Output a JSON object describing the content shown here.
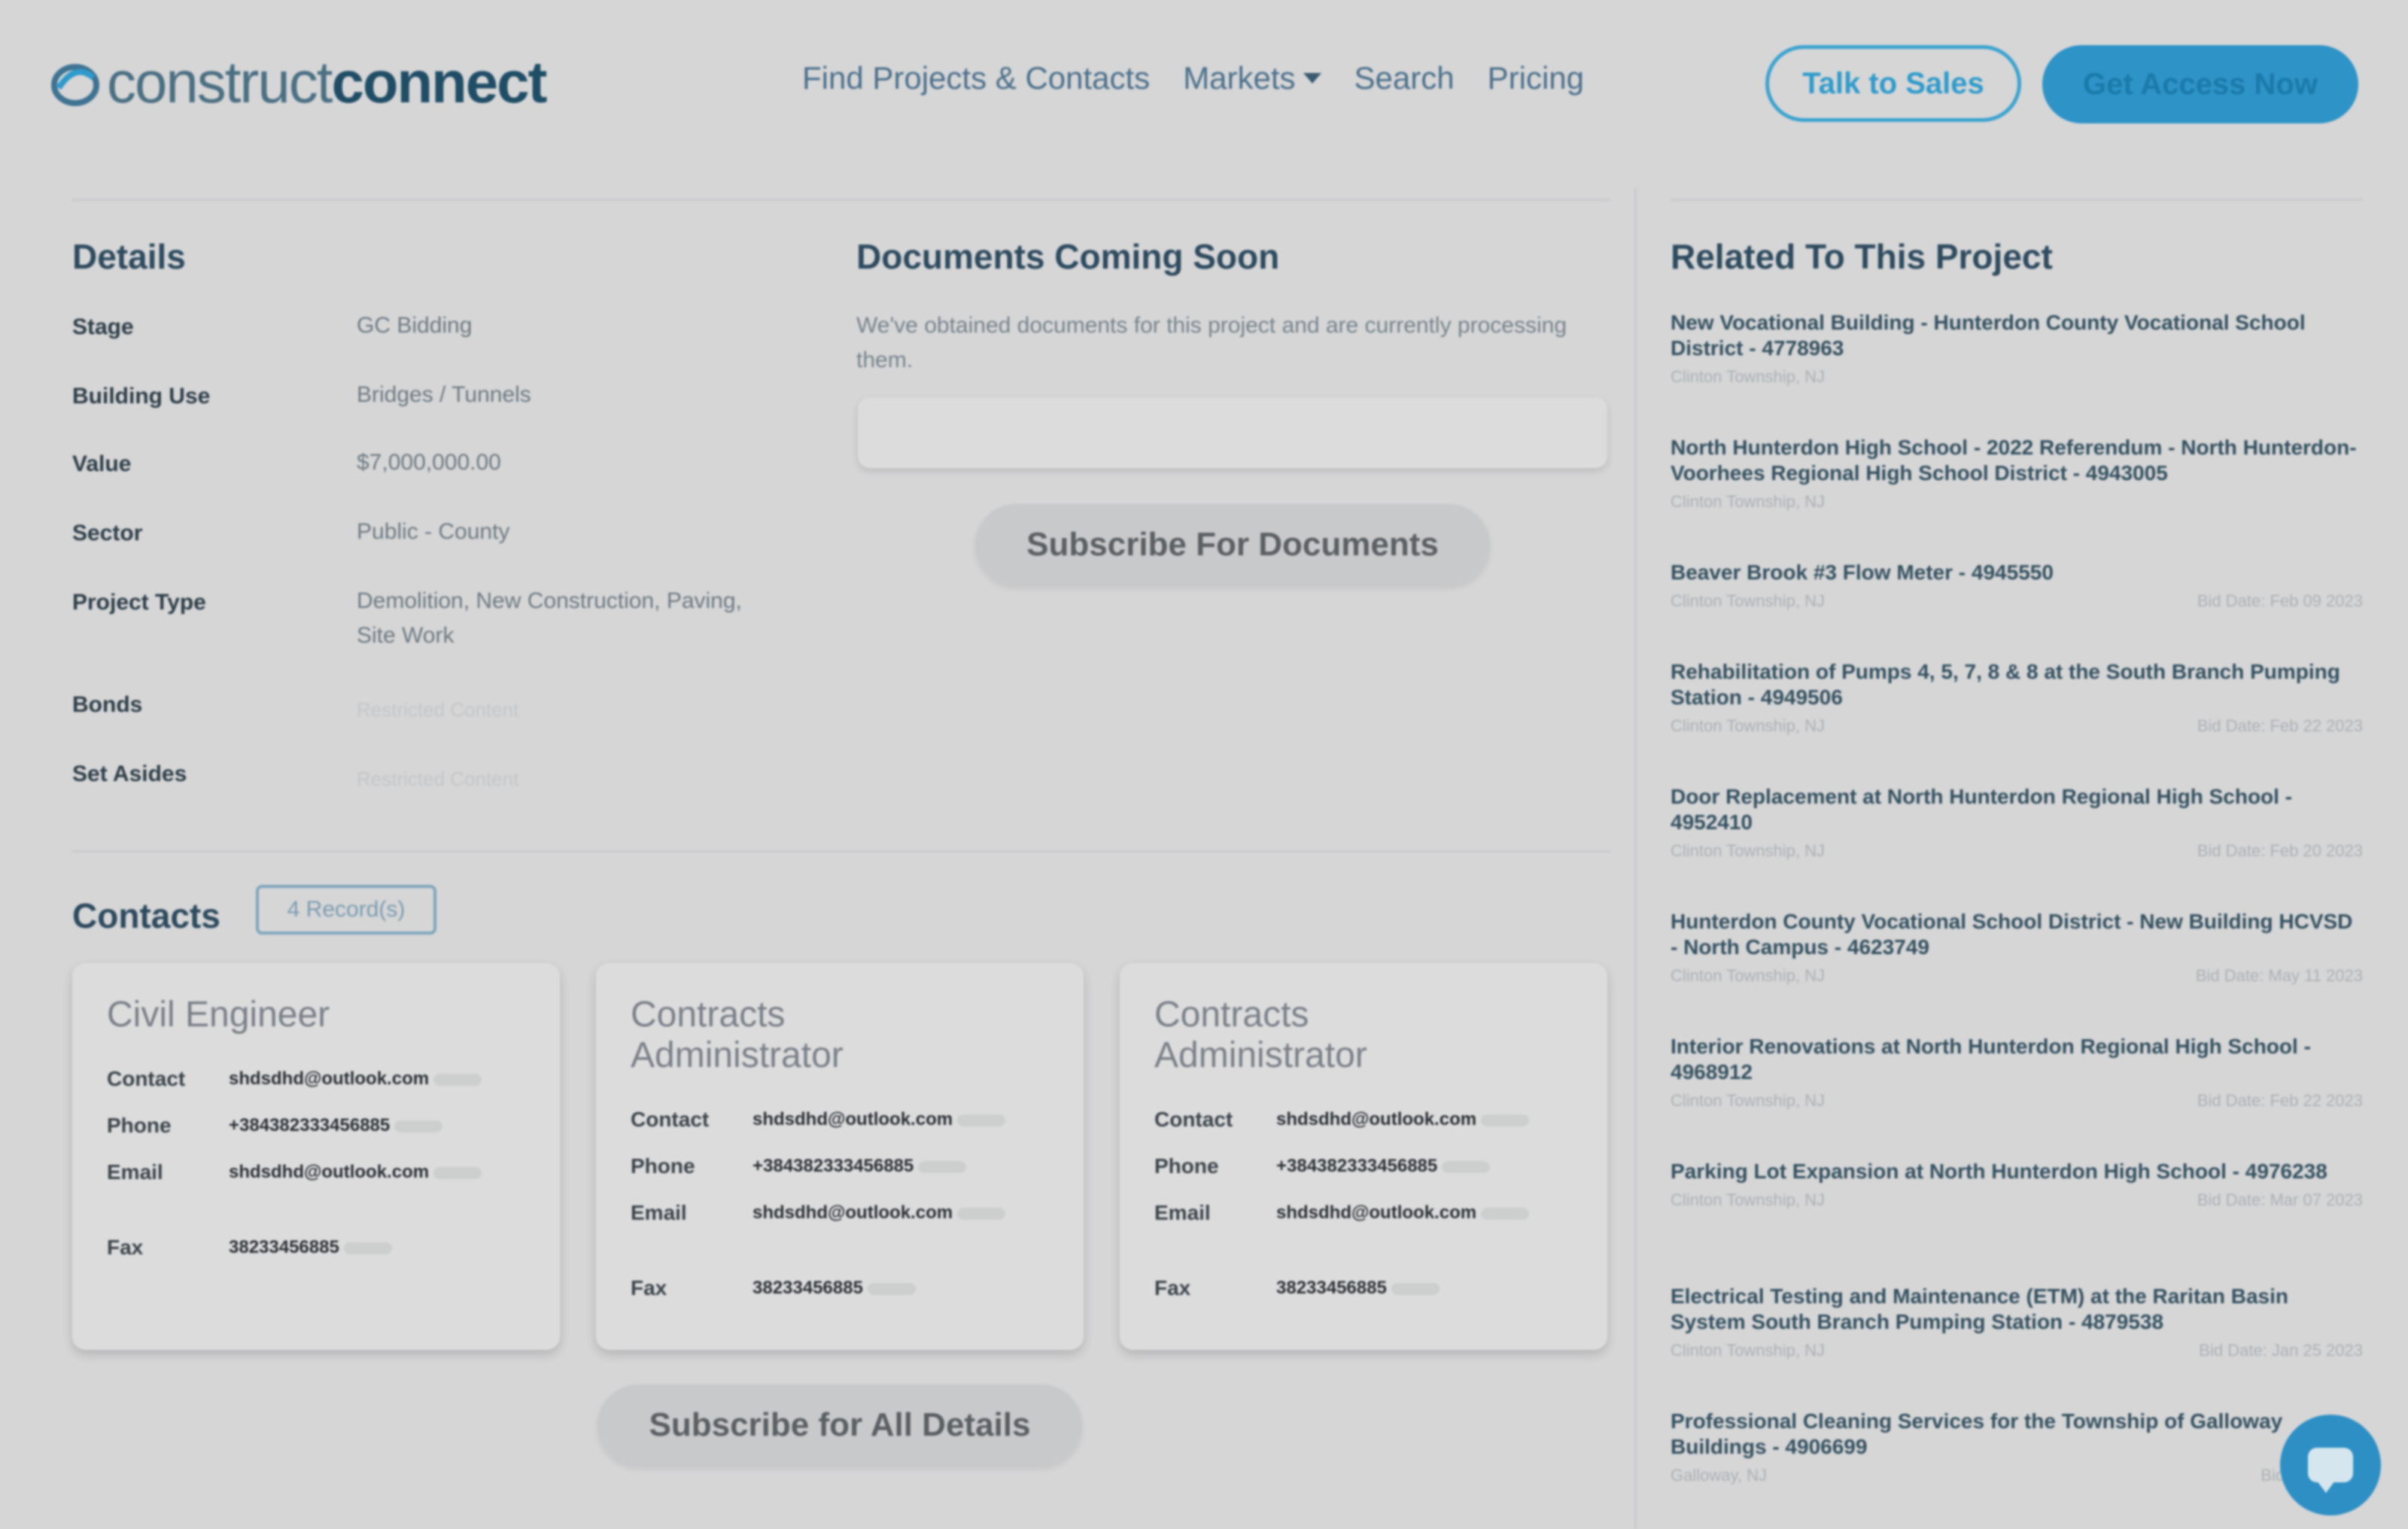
{
  "header": {
    "logo_light": "construct",
    "logo_bold": "connect",
    "nav": {
      "find": "Find Projects & Contacts",
      "markets": "Markets",
      "search": "Search",
      "pricing": "Pricing"
    },
    "talk_to_sales": "Talk to Sales",
    "get_access": "Get Access Now"
  },
  "details": {
    "heading": "Details",
    "rows": [
      {
        "label": "Stage",
        "value": "GC Bidding"
      },
      {
        "label": "Building Use",
        "value": "Bridges / Tunnels"
      },
      {
        "label": "Value",
        "value": "$7,000,000.00"
      },
      {
        "label": "Sector",
        "value": "Public - County"
      },
      {
        "label": "Project Type",
        "value": "Demolition, New Construction, Paving, Site Work"
      },
      {
        "label": "Bonds",
        "value": "Restricted Content"
      },
      {
        "label": "Set Asides",
        "value": "Restricted Content"
      }
    ]
  },
  "documents": {
    "heading": "Documents Coming Soon",
    "text": "We've obtained documents for this project and are currently processing them.",
    "subscribe": "Subscribe For Documents"
  },
  "contacts": {
    "heading": "Contacts",
    "records": "4 Record(s)",
    "field_labels": {
      "contact": "Contact",
      "phone": "Phone",
      "email": "Email",
      "fax": "Fax"
    },
    "cards": [
      {
        "role": "Civil Engineer",
        "contact": "shdsdhd@outlook.com",
        "phone": "+384382333456885",
        "email": "shdsdhd@outlook.com",
        "fax": "38233456885"
      },
      {
        "role": "Contracts Administrator",
        "contact": "shdsdhd@outlook.com",
        "phone": "+384382333456885",
        "email": "shdsdhd@outlook.com",
        "fax": "38233456885"
      },
      {
        "role": "Contracts Administrator",
        "contact": "shdsdhd@outlook.com",
        "phone": "+384382333456885",
        "email": "shdsdhd@outlook.com",
        "fax": "38233456885"
      }
    ],
    "subscribe_all": "Subscribe for All Details"
  },
  "related": {
    "heading": "Related To This Project",
    "items": [
      {
        "title": "New Vocational Building - Hunterdon County Vocational School District - 4778963",
        "city": "Clinton Township, NJ",
        "bid": ""
      },
      {
        "title": "North Hunterdon High School - 2022 Referendum - North Hunterdon-Voorhees Regional High School District - 4943005",
        "city": "Clinton Township, NJ",
        "bid": ""
      },
      {
        "title": "Beaver Brook #3 Flow Meter - 4945550",
        "city": "Clinton Township, NJ",
        "bid": "Bid Date: Feb 09 2023"
      },
      {
        "title": "Rehabilitation of Pumps 4, 5, 7, 8 & 8 at the South Branch Pumping Station - 4949506",
        "city": "Clinton Township, NJ",
        "bid": "Bid Date: Feb 22 2023"
      },
      {
        "title": "Door Replacement at North Hunterdon Regional High School - 4952410",
        "city": "Clinton Township, NJ",
        "bid": "Bid Date: Feb 20 2023"
      },
      {
        "title": "Hunterdon County Vocational School District - New Building HCVSD - North Campus - 4623749",
        "city": "Clinton Township, NJ",
        "bid": "Bid Date: May 11 2023"
      },
      {
        "title": "Interior Renovations at North Hunterdon Regional High School - 4968912",
        "city": "Clinton Township, NJ",
        "bid": "Bid Date: Feb 22 2023"
      },
      {
        "title": "Parking Lot Expansion at North Hunterdon High School - 4976238",
        "city": "Clinton Township, NJ",
        "bid": "Bid Date: Mar 07 2023"
      },
      {
        "title": "Electrical Testing and Maintenance (ETM) at the Raritan Basin System South Branch Pumping Station - 4879538",
        "city": "Clinton Township, NJ",
        "bid": "Bid Date: Jan 25 2023"
      },
      {
        "title": "Professional Cleaning Services for the Township of Galloway Buildings - 4906699",
        "city": "Galloway, NJ",
        "bid": "Bid Date: Dec"
      }
    ]
  },
  "colors": {
    "accent": "#2e93c7",
    "heading": "#2d4a5e",
    "background": "#d6d6d7"
  }
}
